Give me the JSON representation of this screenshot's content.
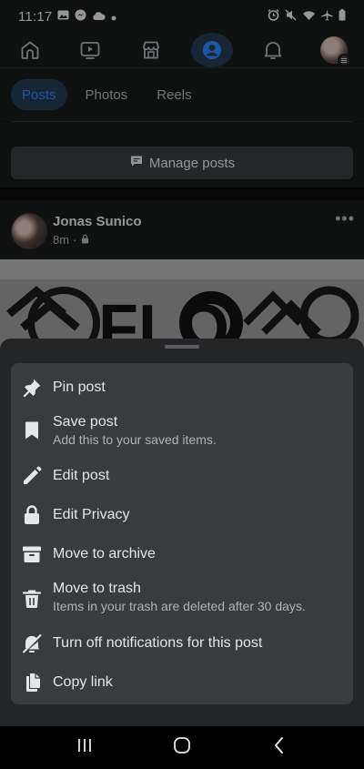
{
  "status_bar": {
    "time": "11:17",
    "left_icons": [
      "gallery-icon",
      "messenger-icon",
      "cloud-icon",
      "dot-icon"
    ],
    "right_icons": [
      "alarm-icon",
      "mute-icon",
      "wifi-icon",
      "airplane-icon",
      "battery-icon"
    ]
  },
  "nav": {
    "items": [
      "home-icon",
      "video-icon",
      "marketplace-icon",
      "profile-icon",
      "bell-icon",
      "menu-avatar"
    ],
    "active": "profile-icon",
    "accent": "#2d88ff"
  },
  "tabs": [
    {
      "label": "Posts",
      "active": true
    },
    {
      "label": "Photos",
      "active": false
    },
    {
      "label": "Reels",
      "active": false
    }
  ],
  "manage_posts": {
    "label": "Manage posts"
  },
  "post": {
    "author": "Jonas Sunico",
    "time": "8m",
    "separator": "·",
    "image_text": "FLO"
  },
  "menu": {
    "items": [
      {
        "icon": "pin-icon",
        "label": "Pin post",
        "sub": ""
      },
      {
        "icon": "bookmark-icon",
        "label": "Save post",
        "sub": "Add this to your saved items."
      },
      {
        "icon": "pencil-icon",
        "label": "Edit post",
        "sub": ""
      },
      {
        "icon": "lock-icon",
        "label": "Edit Privacy",
        "sub": ""
      },
      {
        "icon": "archive-icon",
        "label": "Move to archive",
        "sub": ""
      },
      {
        "icon": "trash-icon",
        "label": "Move to trash",
        "sub": "Items in your trash are deleted after 30 days."
      },
      {
        "icon": "bell-off-icon",
        "label": "Turn off notifications for this post",
        "sub": ""
      },
      {
        "icon": "copy-icon",
        "label": "Copy link",
        "sub": ""
      }
    ]
  },
  "system_nav": [
    "recents-icon",
    "home-button-icon",
    "back-icon"
  ]
}
